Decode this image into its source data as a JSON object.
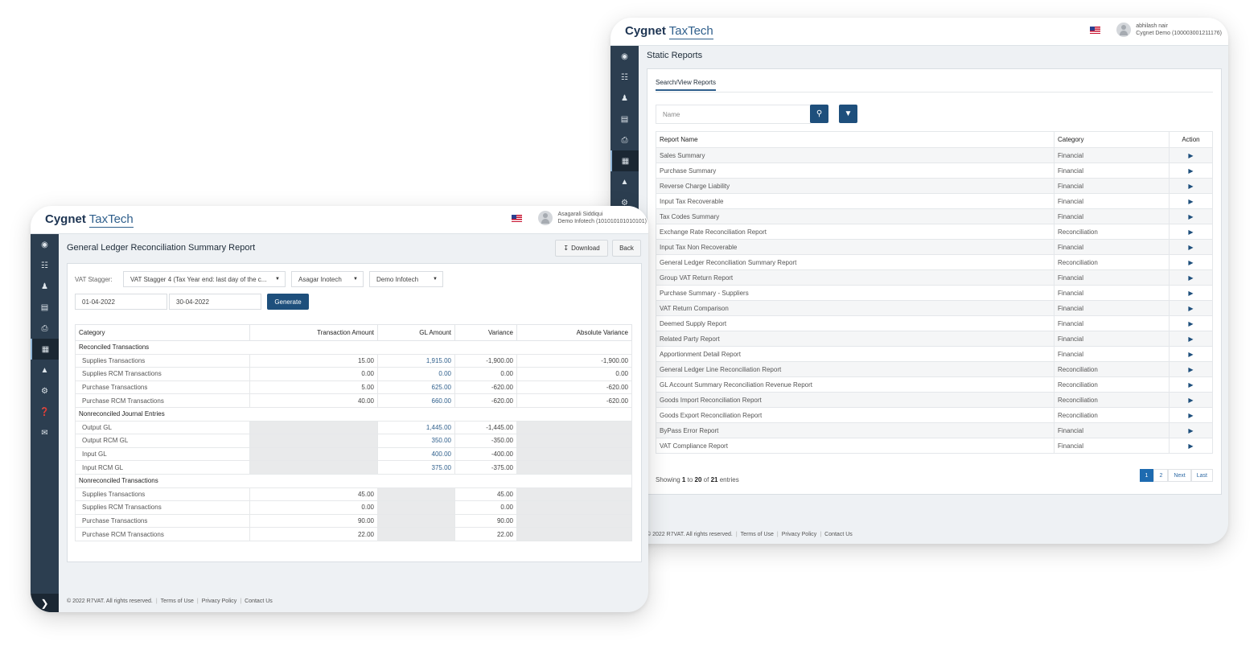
{
  "back_window": {
    "logo": {
      "bold": "Cygnet",
      "light": "TaxTech"
    },
    "user": {
      "name": "abhilash nair",
      "org": "Cygnet Demo (100003001211176)"
    },
    "page_title": "Static Reports",
    "tab": "Search/View Reports",
    "search_placeholder": "Name",
    "table": {
      "headers": [
        "Report Name",
        "Category",
        "Action"
      ],
      "rows": [
        [
          "Sales Summary",
          "Financial"
        ],
        [
          "Purchase Summary",
          "Financial"
        ],
        [
          "Reverse Charge Liability",
          "Financial"
        ],
        [
          "Input Tax Recoverable",
          "Financial"
        ],
        [
          "Tax Codes Summary",
          "Financial"
        ],
        [
          "Exchange Rate Reconciliation Report",
          "Reconciliation"
        ],
        [
          "Input Tax Non Recoverable",
          "Financial"
        ],
        [
          "General Ledger Reconciliation Summary Report",
          "Reconciliation"
        ],
        [
          "Group VAT Return Report",
          "Financial"
        ],
        [
          "Purchase Summary - Suppliers",
          "Financial"
        ],
        [
          "VAT Return Comparison",
          "Financial"
        ],
        [
          "Deemed Supply Report",
          "Financial"
        ],
        [
          "Related Party Report",
          "Financial"
        ],
        [
          "Apportionment Detail Report",
          "Financial"
        ],
        [
          "General Ledger Line Reconciliation Report",
          "Reconciliation"
        ],
        [
          "GL Account Summary Reconciliation Revenue Report",
          "Reconciliation"
        ],
        [
          "Goods Import Reconciliation Report",
          "Reconciliation"
        ],
        [
          "Goods Export Reconciliation Report",
          "Reconciliation"
        ],
        [
          "ByPass Error Report",
          "Financial"
        ],
        [
          "VAT Compliance Report",
          "Financial"
        ]
      ]
    },
    "showing": {
      "prefix": "Showing",
      "from": "1",
      "to_word": "to",
      "to": "20",
      "of_word": "of",
      "total": "21",
      "suffix": "entries"
    },
    "pager": {
      "p1": "1",
      "p2": "2",
      "next": "Next",
      "last": "Last"
    },
    "footer": {
      "copyright": "© 2022 R7VAT. All rights reserved.",
      "terms": "Terms of Use",
      "privacy": "Privacy Policy",
      "contact": "Contact Us"
    }
  },
  "front_window": {
    "logo": {
      "bold": "Cygnet",
      "light": "TaxTech"
    },
    "user": {
      "name": "Asagarali Siddiqui",
      "org": "Demo Infotech (101010101010101)"
    },
    "page_title": "General Ledger Reconciliation Summary Report",
    "download_label": "Download",
    "back_label": "Back",
    "filters": {
      "vat_stagger_label": "VAT Stagger:",
      "vat_stagger_value": "VAT Stagger 4 (Tax Year end: last day of the c...",
      "entity_value": "Asagar Inotech",
      "company_value": "Demo Infotech",
      "from_date": "01-04-2022",
      "to_date": "30-04-2022",
      "generate_label": "Generate"
    },
    "table": {
      "headers": [
        "Category",
        "Transaction Amount",
        "GL Amount",
        "Variance",
        "Absolute Variance"
      ],
      "sections": [
        {
          "title": "Reconciled Transactions",
          "rows": [
            {
              "name": "Supplies Transactions",
              "txn": "15.00",
              "gl": "1,915.00",
              "var": "-1,900.00",
              "abs": "-1,900.00"
            },
            {
              "name": "Supplies RCM Transactions",
              "txn": "0.00",
              "gl": "0.00",
              "var": "0.00",
              "abs": "0.00"
            },
            {
              "name": "Purchase Transactions",
              "txn": "5.00",
              "gl": "625.00",
              "var": "-620.00",
              "abs": "-620.00"
            },
            {
              "name": "Purchase RCM Transactions",
              "txn": "40.00",
              "gl": "660.00",
              "var": "-620.00",
              "abs": "-620.00"
            }
          ]
        },
        {
          "title": "Nonreconciled Journal Entries",
          "rows": [
            {
              "name": "Output GL",
              "txn": "",
              "gl": "1,445.00",
              "var": "-1,445.00",
              "abs": ""
            },
            {
              "name": "Output RCM GL",
              "txn": "",
              "gl": "350.00",
              "var": "-350.00",
              "abs": ""
            },
            {
              "name": "Input GL",
              "txn": "",
              "gl": "400.00",
              "var": "-400.00",
              "abs": ""
            },
            {
              "name": "Input RCM GL",
              "txn": "",
              "gl": "375.00",
              "var": "-375.00",
              "abs": ""
            }
          ]
        },
        {
          "title": "Nonreconciled Transactions",
          "rows": [
            {
              "name": "Supplies Transactions",
              "txn": "45.00",
              "gl": "",
              "var": "45.00",
              "abs": ""
            },
            {
              "name": "Supplies RCM Transactions",
              "txn": "0.00",
              "gl": "",
              "var": "0.00",
              "abs": ""
            },
            {
              "name": "Purchase Transactions",
              "txn": "90.00",
              "gl": "",
              "var": "90.00",
              "abs": ""
            },
            {
              "name": "Purchase RCM Transactions",
              "txn": "22.00",
              "gl": "",
              "var": "22.00",
              "abs": ""
            }
          ]
        }
      ]
    },
    "footer": {
      "copyright": "© 2022 R7VAT. All rights reserved.",
      "terms": "Terms of Use",
      "privacy": "Privacy Policy",
      "contact": "Contact Us"
    }
  },
  "sidebar_icons": [
    "dashboard-icon",
    "sitemap-icon",
    "user-icon",
    "document-icon",
    "print-icon",
    "table-icon",
    "upload-icon",
    "gear-icon",
    "help-icon",
    "megaphone-icon"
  ],
  "colors": {
    "sidebar": "#2c3e50",
    "primary_button": "#1e4f7c",
    "active_page": "#1e6bb0"
  }
}
